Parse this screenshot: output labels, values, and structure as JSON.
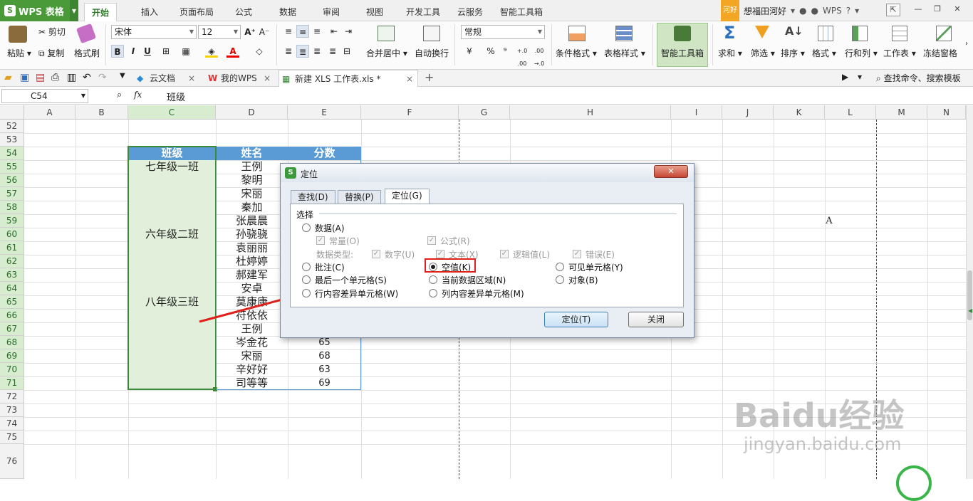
{
  "app": {
    "name": "WPS 表格"
  },
  "menu_tabs": [
    "开始",
    "插入",
    "页面布局",
    "公式",
    "数据",
    "审阅",
    "视图",
    "开发工具",
    "云服务",
    "智能工具箱"
  ],
  "user": {
    "badge": "河好",
    "name": "想福田河好"
  },
  "system_icons": {
    "wps": "WPS",
    "help": "?"
  },
  "ribbon": {
    "clipboard": {
      "paste": "粘贴",
      "cut": "剪切",
      "copy": "复制",
      "format_painter": "格式刷"
    },
    "font": {
      "name": "宋体",
      "size": "12",
      "bold": "B",
      "italic": "I",
      "underline": "U"
    },
    "alignment": {
      "merge": "合并居中",
      "wrap": "自动换行"
    },
    "number": {
      "format": "常规",
      "percent": "%",
      "comma": "⁹",
      "inc": "+.0 .00",
      "dec": ".00 →.0"
    },
    "styles": {
      "conditional": "条件格式",
      "table_style": "表格样式"
    },
    "smart_toolbox": "智能工具箱",
    "editing": {
      "sum": "求和",
      "filter": "筛选",
      "sort": "排序",
      "format": "格式",
      "row_col": "行和列",
      "sheet": "工作表",
      "freeze": "冻结窗格"
    }
  },
  "doc_tabs": [
    {
      "label": "云文档"
    },
    {
      "label": "我的WPS"
    },
    {
      "label": "新建 XLS 工作表.xls *"
    }
  ],
  "search_command": "查找命令、搜索模板",
  "formula_bar": {
    "name_box": "C54",
    "fx": "fx",
    "value": "班级"
  },
  "columns": [
    "A",
    "B",
    "C",
    "D",
    "E",
    "F",
    "G",
    "H",
    "I",
    "J",
    "K",
    "L",
    "M",
    "N"
  ],
  "rows": [
    "52",
    "53",
    "54",
    "55",
    "56",
    "57",
    "58",
    "59",
    "60",
    "61",
    "62",
    "63",
    "64",
    "65",
    "66",
    "67",
    "68",
    "69",
    "70",
    "71",
    "72",
    "73",
    "74",
    "75",
    "76"
  ],
  "table": {
    "headers": [
      "班级",
      "姓名",
      "分数"
    ],
    "classes": [
      "七年级一班",
      "六年级二班",
      "八年级三班"
    ],
    "names": [
      "王例",
      "黎明",
      "宋丽",
      "秦加",
      "张晨晨",
      "孙骁骁",
      "袁丽丽",
      "杜婷婷",
      "郝建军",
      "安卓",
      "莫康康",
      "符依依",
      "王例",
      "岑金花",
      "宋丽",
      "辛好好",
      "司等等"
    ],
    "scores_visible": [
      "65",
      "68",
      "63",
      "69"
    ]
  },
  "stray_cell": {
    "value": "A"
  },
  "dialog": {
    "title": "定位",
    "tabs": [
      "查找(D)",
      "替换(P)",
      "定位(G)"
    ],
    "group_label": "选择",
    "options": {
      "data": "数据(A)",
      "constant": "常量(O)",
      "formula": "公式(R)",
      "data_type": "数据类型:",
      "number": "数字(U)",
      "text": "文本(X)",
      "logical": "逻辑值(L)",
      "error": "错误(E)",
      "comment": "批注(C)",
      "blank": "空值(K)",
      "visible_cells": "可见单元格(Y)",
      "last_cell": "最后一个单元格(S)",
      "current_region": "当前数据区域(N)",
      "objects": "对象(B)",
      "row_diff": "行内容差异单元格(W)",
      "col_diff": "列内容差异单元格(M)"
    },
    "buttons": {
      "locate": "定位(T)",
      "close": "关闭"
    }
  },
  "watermark": {
    "brand": "Baidu经验",
    "url": "jingyan.baidu.com"
  },
  "colors": {
    "app_green": "#4a9a3a",
    "header_fill": "#5b9bd5",
    "selection": "#e2efda",
    "selection_border": "#3a8a3a",
    "highlight": "#e0201a"
  }
}
